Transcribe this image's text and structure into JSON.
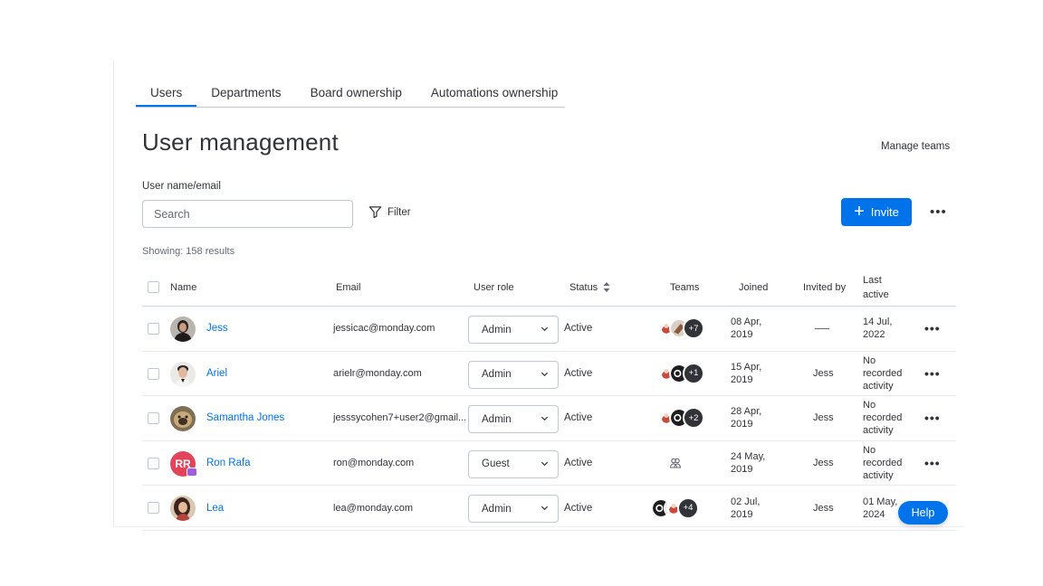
{
  "tabs": [
    {
      "label": "Users",
      "active": true
    },
    {
      "label": "Departments",
      "active": false
    },
    {
      "label": "Board ownership",
      "active": false
    },
    {
      "label": "Automations ownership",
      "active": false
    }
  ],
  "page_title": "User management",
  "manage_teams_label": "Manage teams",
  "search": {
    "label": "User name/email",
    "placeholder": "Search",
    "value": ""
  },
  "filter_label": "Filter",
  "invite_label": "Invite",
  "more_icon": "more-horizontal-icon",
  "showing_text": "Showing: 158 results",
  "table": {
    "headers": {
      "name": "Name",
      "email": "Email",
      "user_role": "User role",
      "status": "Status",
      "teams": "Teams",
      "joined": "Joined",
      "invited_by": "Invited by",
      "last_active": "Last active"
    },
    "rows": [
      {
        "name": "Jess",
        "email": "jessicac@monday.com",
        "role": "Admin",
        "status": "Active",
        "teams_more": "+7",
        "joined": "08 Apr, 2019",
        "invited_by": "",
        "last_active": "14 Jul, 2022"
      },
      {
        "name": "Ariel",
        "email": "arielr@monday.com",
        "role": "Admin",
        "status": "Active",
        "teams_more": "+1",
        "joined": "15 Apr, 2019",
        "invited_by": "Jess",
        "last_active": "No recorded activity"
      },
      {
        "name": "Samantha Jones",
        "email": "jesssycohen7+user2@gmail...",
        "role": "Admin",
        "status": "Active",
        "teams_more": "+2",
        "joined": "28 Apr, 2019",
        "invited_by": "Jess",
        "last_active": "No recorded activity"
      },
      {
        "name": "Ron Rafa",
        "avatar_initials": "RR",
        "email": "ron@monday.com",
        "role": "Guest",
        "status": "Active",
        "teams_more": "",
        "joined": "24 May, 2019",
        "invited_by": "Jess",
        "last_active": "No recorded activity"
      },
      {
        "name": "Lea",
        "email": "lea@monday.com",
        "role": "Admin",
        "status": "Active",
        "teams_more": "+4",
        "joined": "02 Jul, 2019",
        "invited_by": "Jess",
        "last_active": "01 May, 2024"
      }
    ]
  },
  "help_label": "Help",
  "colors": {
    "accent": "#0073ea",
    "text": "#323338",
    "muted": "#676879",
    "border": "#c3c6d4",
    "guest_avatar": "#e2445c"
  }
}
